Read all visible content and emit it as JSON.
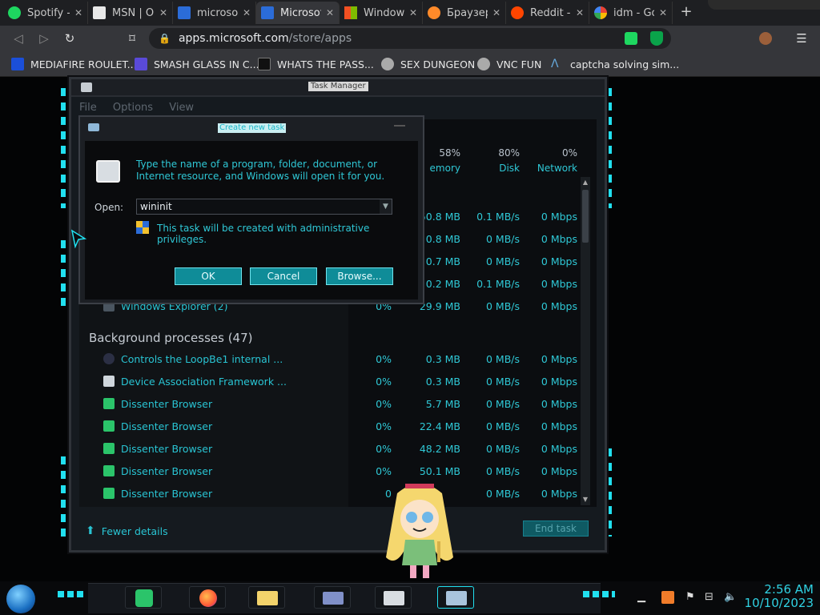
{
  "browser": {
    "tabs": [
      {
        "label": "Spotify -",
        "icon": "spotify-icon",
        "color": "#1ed760"
      },
      {
        "label": "MSN | O",
        "icon": "msn-icon",
        "color": "#f0f0f0"
      },
      {
        "label": "microsof",
        "icon": "microsoft-icon",
        "color": "#2b6cd8"
      },
      {
        "label": "Microsof",
        "icon": "microsoft-icon",
        "color": "#2b6cd8"
      },
      {
        "label": "Window",
        "icon": "windows-logo-icon",
        "color": "#f25022"
      },
      {
        "label": "Браузер",
        "icon": "cloud-icon",
        "color": "#ff8a2a"
      },
      {
        "label": "Reddit -",
        "icon": "reddit-icon",
        "color": "#ff4500"
      },
      {
        "label": "idm - Go",
        "icon": "google-icon",
        "color": "#4285f4"
      }
    ],
    "url_host": "apps.microsoft.com",
    "url_path": "/store/apps",
    "bookmarks": [
      {
        "label": "MEDIAFIRE ROULET...",
        "icon": "mediafire-icon"
      },
      {
        "label": "SMASH GLASS IN C...",
        "icon": "bookmark-icon"
      },
      {
        "label": "WHATS THE PASS...",
        "icon": "bookmark-icon"
      },
      {
        "label": "SEX DUNGEON",
        "icon": "bookmark-icon"
      },
      {
        "label": "VNC FUN",
        "icon": "bookmark-icon"
      },
      {
        "label": "captcha solving sim...",
        "icon": "bookmark-icon"
      }
    ]
  },
  "task_manager": {
    "title": "Task Manager",
    "menu": [
      "File",
      "Options",
      "View"
    ],
    "headers": {
      "memory_pct": "58%",
      "memory_label": "emory",
      "disk_pct": "80%",
      "disk_label": "Disk",
      "network_pct": "0%",
      "network_label": "Network"
    },
    "apps_rows": [
      {
        "mem": "50.8 MB",
        "disk": "0.1 MB/s",
        "net": "0 Mbps"
      },
      {
        "mem": "0.8 MB",
        "disk": "0 MB/s",
        "net": "0 Mbps"
      },
      {
        "mem": "0.7 MB",
        "disk": "0 MB/s",
        "net": "0 Mbps"
      },
      {
        "mem": "0.2 MB",
        "disk": "0.1 MB/s",
        "net": "0 Mbps"
      },
      {
        "name": "Windows Explorer (2)",
        "cpu": "0%",
        "mem": "29.9 MB",
        "disk": "0 MB/s",
        "net": "0 Mbps"
      }
    ],
    "background_title": "Background processes (47)",
    "background_rows": [
      {
        "name": "Controls the LoopBe1 internal ...",
        "cpu": "0%",
        "mem": "0.3 MB",
        "disk": "0 MB/s",
        "net": "0 Mbps"
      },
      {
        "name": "Device Association Framework ...",
        "cpu": "0%",
        "mem": "0.3 MB",
        "disk": "0 MB/s",
        "net": "0 Mbps"
      },
      {
        "name": "Dissenter Browser",
        "cpu": "0%",
        "mem": "5.7 MB",
        "disk": "0 MB/s",
        "net": "0 Mbps"
      },
      {
        "name": "Dissenter Browser",
        "cpu": "0%",
        "mem": "22.4 MB",
        "disk": "0 MB/s",
        "net": "0 Mbps"
      },
      {
        "name": "Dissenter Browser",
        "cpu": "0%",
        "mem": "48.2 MB",
        "disk": "0 MB/s",
        "net": "0 Mbps"
      },
      {
        "name": "Dissenter Browser",
        "cpu": "0%",
        "mem": "50.1 MB",
        "disk": "0 MB/s",
        "net": "0 Mbps"
      },
      {
        "name": "Dissenter Browser",
        "cpu": "0",
        "mem": "",
        "disk": "0 MB/s",
        "net": "0 Mbps"
      }
    ],
    "fewer_details": "Fewer details",
    "end_task": "End task"
  },
  "run_dialog": {
    "title": "Create new task",
    "description": "Type the name of a program, folder, document, or Internet resource, and Windows will open it for you.",
    "open_label": "Open:",
    "open_value": "wininit",
    "admin_note": "This task will be created with administrative privileges.",
    "ok": "OK",
    "cancel": "Cancel",
    "browse": "Browse..."
  },
  "taskbar": {
    "time": "2:56 AM",
    "date": "10/10/2023"
  },
  "colors": {
    "accent": "#2fc8d6",
    "window_bg": "#151a1f",
    "button": "#0f8c98"
  }
}
